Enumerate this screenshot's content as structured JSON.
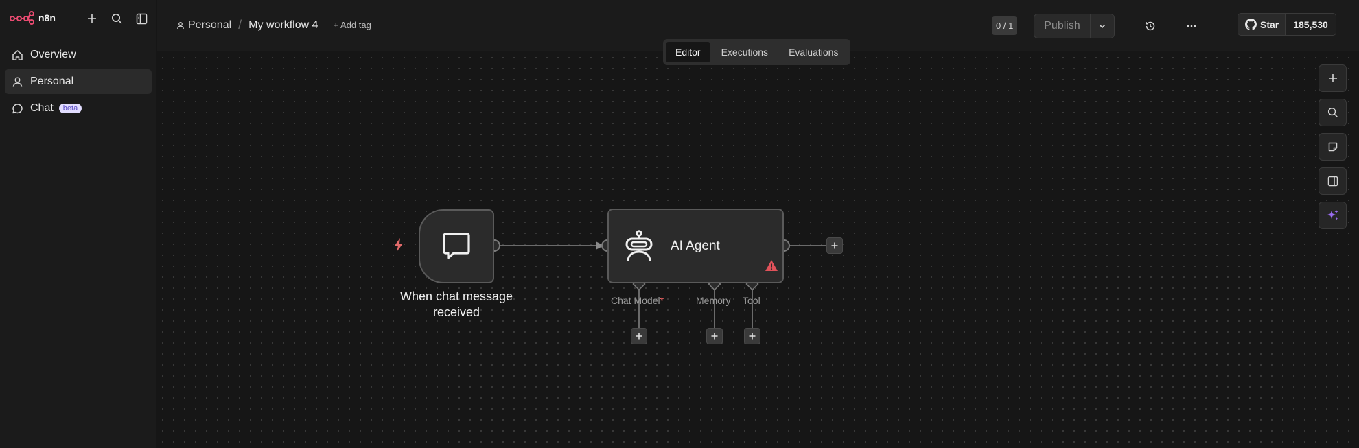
{
  "brand": {
    "name": "n8n"
  },
  "sidebar": {
    "items": [
      {
        "label": "Overview",
        "icon": "home-icon"
      },
      {
        "label": "Personal",
        "icon": "user-icon",
        "active": true
      },
      {
        "label": "Chat",
        "icon": "chat-bubble-icon",
        "badge": "beta"
      }
    ]
  },
  "header": {
    "owner": "Personal",
    "separator": "/",
    "workflow_title": "My workflow 4",
    "add_tag": "+ Add tag",
    "counter": "0 / 1",
    "publish_label": "Publish",
    "github": {
      "star_label": "Star",
      "count": "185,530"
    }
  },
  "tabs": [
    {
      "label": "Editor",
      "active": true
    },
    {
      "label": "Executions"
    },
    {
      "label": "Evaluations"
    }
  ],
  "nodes": {
    "trigger": {
      "label": "When chat message received",
      "label_line1": "When chat message",
      "label_line2": "received"
    },
    "agent": {
      "title": "AI Agent",
      "ports": [
        {
          "label": "Chat Model",
          "required": "*"
        },
        {
          "label": "Memory"
        },
        {
          "label": "Tool"
        }
      ]
    }
  },
  "colors": {
    "accent_red": "#e26a6a",
    "warning": "#e0525a",
    "magic": "#9b6cf0",
    "brand_pink": "#ea4b71"
  }
}
